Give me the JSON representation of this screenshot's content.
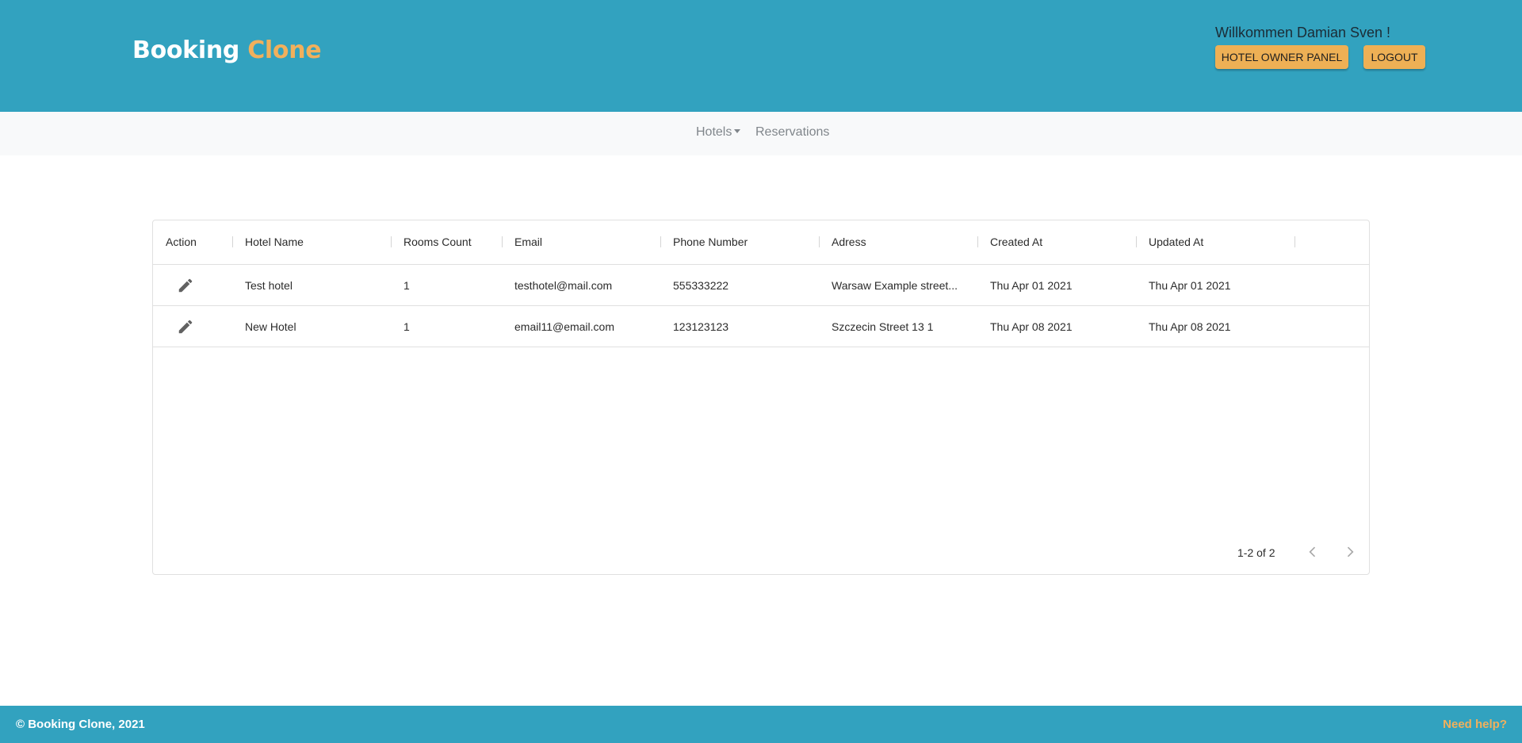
{
  "header": {
    "brand_part1": "Booking",
    "brand_part2": "Clone",
    "welcome": "Willkommen Damian Sven !",
    "owner_panel_label": "HOTEL OWNER PANEL",
    "logout_label": "LOGOUT"
  },
  "nav": {
    "hotels_label": "Hotels",
    "reservations_label": "Reservations"
  },
  "table": {
    "columns": [
      "Action",
      "Hotel Name",
      "Rooms Count",
      "Email",
      "Phone Number",
      "Adress",
      "Created At",
      "Updated At"
    ],
    "rows": [
      {
        "hotel_name": "Test hotel",
        "rooms_count": "1",
        "email": "testhotel@mail.com",
        "phone": "555333222",
        "address": "Warsaw Example street...",
        "created_at": "Thu Apr 01 2021",
        "updated_at": "Thu Apr 01 2021"
      },
      {
        "hotel_name": "New Hotel",
        "rooms_count": "1",
        "email": "email11@email.com",
        "phone": "123123123",
        "address": "Szczecin Street 13 1",
        "created_at": "Thu Apr 08 2021",
        "updated_at": "Thu Apr 08 2021"
      }
    ],
    "pagination": "1-2 of 2"
  },
  "footer": {
    "copyright": "© Booking Clone, 2021",
    "help": "Need help?"
  },
  "colors": {
    "header_bg": "#32a2bf",
    "accent": "#eeb055"
  },
  "icons": [
    "pencil-icon",
    "chevron-left-icon",
    "chevron-right-icon"
  ]
}
